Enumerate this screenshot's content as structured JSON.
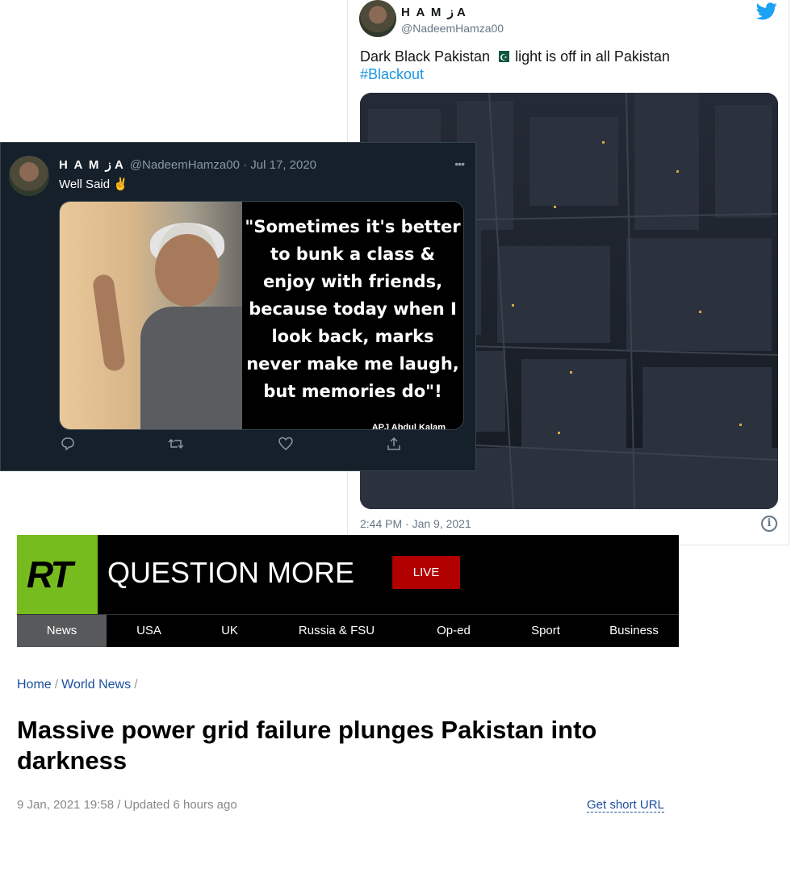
{
  "light_tweet": {
    "display_name": "H A M ز A",
    "handle": "@NadeemHamza00",
    "text_before_flag": "Dark Black Pakistan",
    "text_after_flag": "light is off in all Pakistan",
    "hashtag": "#Blackout",
    "timestamp": "2:44 PM · Jan 9, 2021",
    "info_glyph": "i",
    "icons": [
      "twitter-bird-icon",
      "pakistan-flag-icon",
      "info-icon"
    ]
  },
  "dark_tweet": {
    "display_name": "H A M ز A",
    "handle": "@NadeemHamza00",
    "date": "· Jul 17, 2020",
    "more": "•••",
    "text": "Well Said ✌",
    "quote": "\"Sometimes it's better to bunk a class & enjoy with friends, because today when I look back, marks never make me laugh, but memories do\"!",
    "quote_caption": "APJ Abdul Kalam",
    "actions": [
      "reply-icon",
      "retweet-icon",
      "like-icon",
      "share-icon"
    ]
  },
  "rt": {
    "logo": "RT",
    "tagline": "QUESTION MORE",
    "live_label": "LIVE",
    "nav": [
      "News",
      "USA",
      "UK",
      "Russia & FSU",
      "Op-ed",
      "Sport",
      "Business"
    ],
    "active_nav": "News",
    "brand_green": "#77bc1f",
    "live_red": "#b10000"
  },
  "article": {
    "breadcrumb": [
      "Home",
      "World News"
    ],
    "headline": "Massive power grid failure plunges Pakistan into darkness",
    "meta": "9 Jan, 2021 19:58 / Updated 6 hours ago",
    "short_url_label": "Get short URL"
  }
}
